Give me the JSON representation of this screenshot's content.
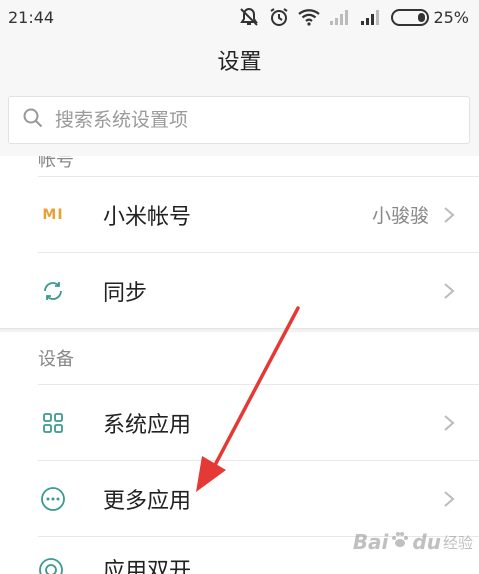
{
  "status_bar": {
    "time": "21:44",
    "battery_percent": "25%",
    "battery_level": 0.25,
    "icons": [
      "notification-muted-icon",
      "alarm-icon",
      "wifi-icon",
      "signal-sim2-icon",
      "signal-sim1-icon",
      "battery-icon"
    ]
  },
  "title": "设置",
  "search": {
    "placeholder": "搜索系统设置项",
    "value": ""
  },
  "sections": {
    "account": {
      "header": "帐号",
      "items": [
        {
          "label": "小米帐号",
          "value": "小骏骏",
          "icon": "mi-logo-icon",
          "mi_text": "MI"
        },
        {
          "label": "同步",
          "icon": "sync-icon"
        }
      ]
    },
    "device": {
      "header": "设备",
      "items": [
        {
          "label": "系统应用",
          "icon": "grid-apps-icon"
        },
        {
          "label": "更多应用",
          "icon": "more-dots-icon"
        },
        {
          "label": "应用双开",
          "icon": "dual-apps-icon"
        }
      ]
    }
  },
  "colors": {
    "accent_icon": "#3a9a8f",
    "mi_orange": "#e8a234",
    "arrow_red": "#e53935"
  },
  "watermark": {
    "brand": "Bai",
    "paw": "du",
    "suffix": "经验"
  }
}
